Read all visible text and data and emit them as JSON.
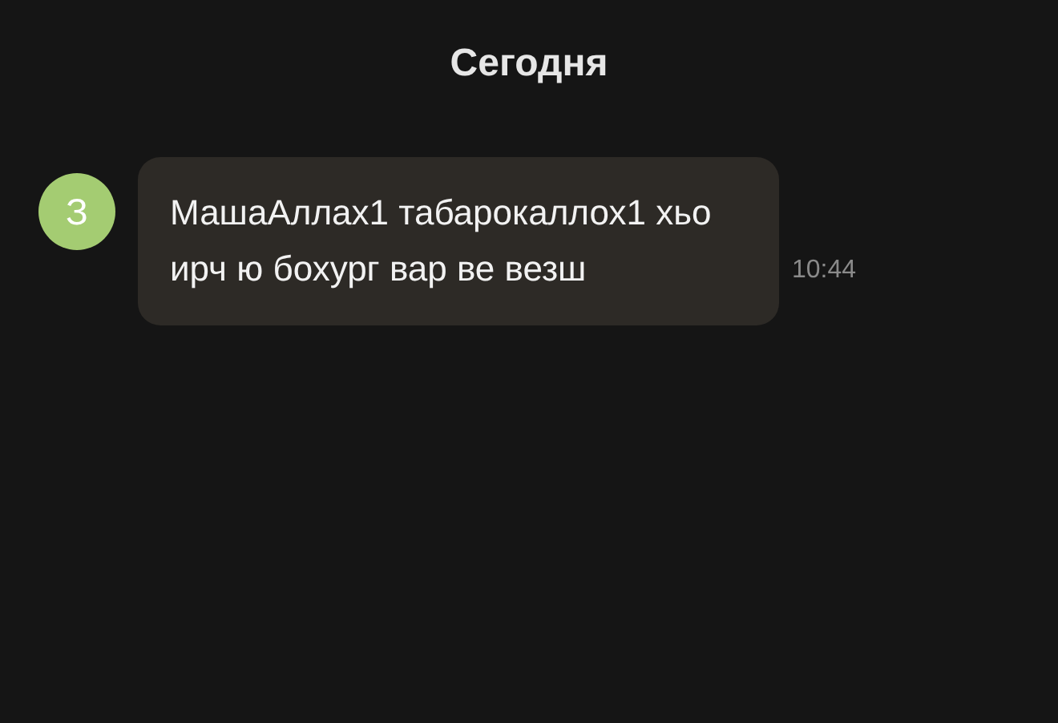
{
  "date_header": "Сегодня",
  "messages": [
    {
      "avatar_initial": "З",
      "text": "МашаАллах1 табарокаллох1 хьо ирч ю бохург вар ве везш",
      "time": "10:44"
    }
  ]
}
